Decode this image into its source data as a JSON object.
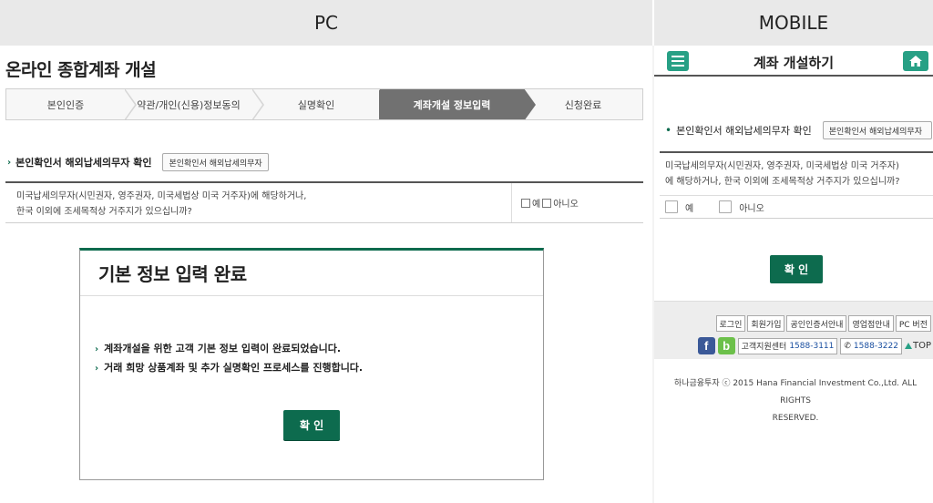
{
  "header": {
    "pc_label": "PC",
    "mobile_label": "MOBILE"
  },
  "pc": {
    "title": "온라인 종합계좌 개설",
    "steps": [
      "본인인증",
      "약관/개인(신용)정보동의",
      "실명확인",
      "계좌개설 정보입력",
      "신청완료"
    ],
    "active_step": "계좌개설 정보입력",
    "confirm_label": "본인확인서 해외납세의무자 확인",
    "confirm_button": "본인확인서 해외납세의무자",
    "question_line1": "미국납세의무자(시민권자, 영주권자, 미국세법상 미국 거주자)에 해당하거나,",
    "question_line2": "한국 이외에 조세목적상 거주지가 있으십니까?",
    "option_yes": "예",
    "option_no": "아니오",
    "modal": {
      "title": "기본 정보 입력 완료",
      "line1": "계좌개설을 위한 고객 기본 정보 입력이 완료되었습니다.",
      "line2": "거래 희망 상품계좌 및 추가 실명확인 프로세스를 진행합니다.",
      "ok_button": "확 인"
    }
  },
  "mobile": {
    "title": "계좌 개설하기",
    "confirm_label": "본인확인서 해외납세의무자 확인",
    "confirm_button": "본인확인서 해외납세의무자",
    "question_line1": "미국납세의무자(시민권자, 영주권자, 미국세법상 미국 거주자)",
    "question_line2": "에 해당하거나, 한국 이외에 조세목적상 거주지가 있으십니까?",
    "option_yes": "예",
    "option_no": "아니오",
    "ok_button": "확 인",
    "footer": {
      "links": [
        "로그인",
        "회원가입",
        "공인인증서안내",
        "영업점안내",
        "PC 버전"
      ],
      "facebook_icon": "f",
      "blog_icon": "b",
      "support_label": "고객지원센터",
      "support_number": "1588-3111",
      "phone_symbol": "✆",
      "phone_number": "1588-3222",
      "top_label": "TOP"
    },
    "copyright_line1": "하나금융투자 ⓒ 2015 Hana Financial Investment Co.,Ltd. ALL RIGHTS",
    "copyright_line2": "RESERVED."
  },
  "colors": {
    "brand_green": "#0d6b4e",
    "mobile_teal": "#27a085",
    "header_gray": "#e9e9e9"
  }
}
